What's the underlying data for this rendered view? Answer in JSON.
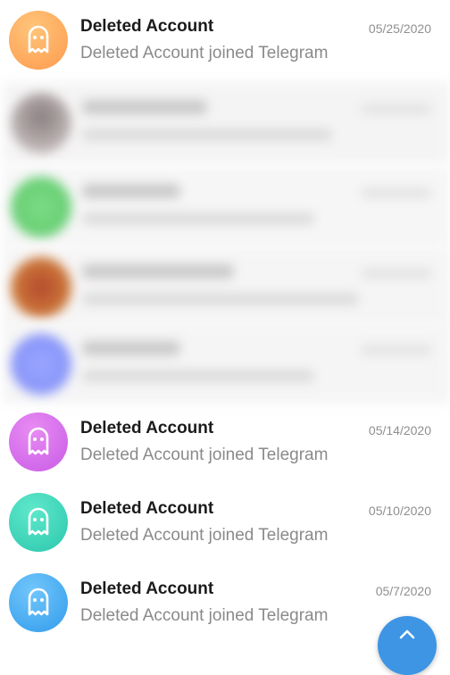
{
  "chats": [
    {
      "name": "Deleted Account",
      "message": "Deleted Account joined Telegram",
      "date": "05/25/2020",
      "avatar_color": "#fda85e"
    },
    {
      "name": "Deleted Account",
      "message": "Deleted Account joined Telegram",
      "date": "05/14/2020",
      "avatar_color": "#d36ce8"
    },
    {
      "name": "Deleted Account",
      "message": "Deleted Account joined Telegram",
      "date": "05/10/2020",
      "avatar_color": "#35d1b6"
    },
    {
      "name": "Deleted Account",
      "message": "Deleted Account joined Telegram",
      "date": "05/7/2020",
      "avatar_color": "#3fa9ef"
    }
  ],
  "redacted_avatar_colors": [
    "#a8a0a0",
    "#6fd37a",
    "#c0603a",
    "#8f9cff"
  ],
  "icons": {
    "avatar": "ghost-icon",
    "fab": "up-arrow-icon"
  },
  "colors": {
    "fab": "#3d95e4",
    "name_text": "#1b1b1b",
    "message_text": "#8a8a8a"
  }
}
